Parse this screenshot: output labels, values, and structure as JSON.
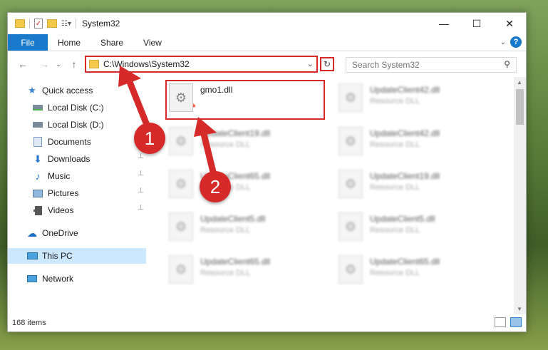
{
  "window": {
    "title": "System32",
    "controls": {
      "minimize": "—",
      "maximize": "☐",
      "close": "✕"
    }
  },
  "ribbon": {
    "tabs": [
      "File",
      "Home",
      "Share",
      "View"
    ],
    "help": "?"
  },
  "address": {
    "path": "C:\\Windows\\System32",
    "search_placeholder": "Search System32"
  },
  "sidebar": {
    "items": [
      {
        "label": "Quick access",
        "icon": "star-icon"
      },
      {
        "label": "Local Disk (C:)",
        "icon": "drive-icon",
        "pinned": true
      },
      {
        "label": "Local Disk (D:)",
        "icon": "drive-icon",
        "pinned": true
      },
      {
        "label": "Documents",
        "icon": "documents-icon",
        "pinned": true
      },
      {
        "label": "Downloads",
        "icon": "download-icon",
        "pinned": true
      },
      {
        "label": "Music",
        "icon": "music-icon",
        "pinned": true
      },
      {
        "label": "Pictures",
        "icon": "pictures-icon",
        "pinned": true
      },
      {
        "label": "Videos",
        "icon": "videos-icon",
        "pinned": true
      },
      {
        "label": "OneDrive",
        "icon": "cloud-icon"
      },
      {
        "label": "This PC",
        "icon": "computer-icon",
        "selected": true
      },
      {
        "label": "Network",
        "icon": "network-icon"
      }
    ]
  },
  "files": [
    {
      "name": "gmo1.dll",
      "type": ""
    },
    {
      "name": "UpdateClient42.dll",
      "type": "Resource DLL"
    },
    {
      "name": "UpdateClient19.dll",
      "type": "Resource DLL"
    },
    {
      "name": "UpdateClient42.dll",
      "type": "Resource DLL"
    },
    {
      "name": "UpdateClient65.dll",
      "type": "Resource DLL"
    },
    {
      "name": "UpdateClient19.dll",
      "type": "Resource DLL"
    },
    {
      "name": "UpdateClient5.dll",
      "type": "Resource DLL"
    },
    {
      "name": "UpdateClient5.dll",
      "type": "Resource DLL"
    },
    {
      "name": "UpdateClient65.dll",
      "type": "Resource DLL"
    },
    {
      "name": "UpdateClient65.dll",
      "type": "Resource DLL"
    }
  ],
  "status": {
    "items_count": "168 items"
  },
  "annotations": {
    "step1": "1",
    "step2": "2",
    "color": "#d62a2a"
  }
}
